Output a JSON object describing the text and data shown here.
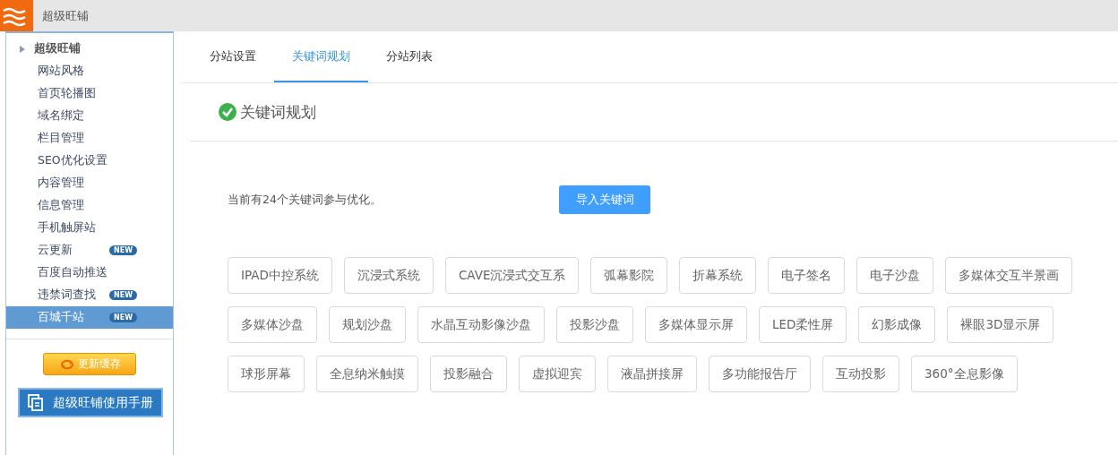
{
  "app_title": "超级旺铺",
  "sidebar": {
    "group": {
      "label": "超级旺铺",
      "expanded": true
    },
    "items": [
      {
        "label": "网站风格",
        "selected": false
      },
      {
        "label": "首页轮播图",
        "selected": false
      },
      {
        "label": "域名绑定",
        "selected": false
      },
      {
        "label": "栏目管理",
        "selected": false
      },
      {
        "label": "SEO优化设置",
        "selected": false
      },
      {
        "label": "内容管理",
        "selected": false
      },
      {
        "label": "信息管理",
        "selected": false
      },
      {
        "label": "手机触屏站",
        "selected": false
      },
      {
        "label": "云更新",
        "selected": false,
        "badge": "NEW"
      },
      {
        "label": "百度自动推送",
        "selected": false
      },
      {
        "label": "违禁词查找",
        "selected": false,
        "badge": "NEW"
      },
      {
        "label": "百城千站",
        "selected": true,
        "badge": "NEW"
      }
    ],
    "refresh_button": "更新缓存",
    "manual_button": "超级旺铺使用手册"
  },
  "tabs": [
    {
      "label": "分站设置",
      "selected": false
    },
    {
      "label": "关键词规划",
      "selected": true
    },
    {
      "label": "分站列表",
      "selected": false
    }
  ],
  "section_title": "关键词规划",
  "summary": "当前有24个关键词参与优化。",
  "import_button": "导入关键词",
  "keyword_rows": [
    [
      "IPAD中控系统",
      "沉浸式系统",
      "CAVE沉浸式交互系",
      "弧幕影院",
      "折幕系统",
      "电子签名",
      "电子沙盘",
      "多媒体交互半景画"
    ],
    [
      "多媒体沙盘",
      "规划沙盘",
      "水晶互动影像沙盘",
      "投影沙盘",
      "多媒体显示屏",
      "LED柔性屏",
      "幻影成像",
      "裸眼3D显示屏"
    ],
    [
      "球形屏幕",
      "全息纳米触摸",
      "投影融合",
      "虚拟迎宾",
      "液晶拼接屏",
      "多功能报告厅",
      "互动投影",
      "360°全息影像"
    ]
  ]
}
